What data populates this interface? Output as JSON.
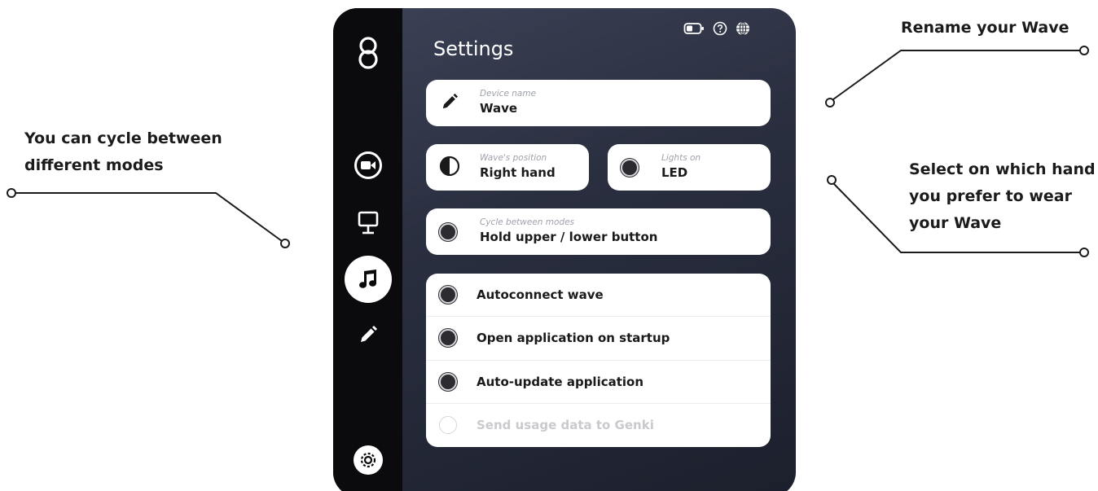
{
  "annotations": {
    "cycle_modes": "You can cycle between different modes",
    "rename": "Rename your Wave",
    "hand": "Select on which hand you prefer to wear your Wave"
  },
  "sidebar": {
    "items": [
      {
        "icon": "logo-icon"
      },
      {
        "icon": "camera-icon"
      },
      {
        "icon": "desktop-icon"
      },
      {
        "icon": "music-icon",
        "active": true
      },
      {
        "icon": "edit-icon"
      },
      {
        "icon": "settings-icon"
      }
    ]
  },
  "header": {
    "title": "Settings",
    "icons": [
      "battery-icon",
      "help-icon",
      "globe-icon"
    ]
  },
  "device_name": {
    "label": "Device name",
    "value": "Wave",
    "icon": "pencil-icon"
  },
  "position": {
    "label": "Wave's position",
    "value": "Right hand",
    "icon": "half-circle-icon"
  },
  "lights": {
    "label": "Lights on",
    "value": "LED"
  },
  "cycle": {
    "label": "Cycle between modes",
    "value": "Hold upper / lower button"
  },
  "toggles": [
    {
      "label": "Autoconnect wave",
      "on": true
    },
    {
      "label": "Open application on startup",
      "on": true
    },
    {
      "label": "Auto-update application",
      "on": true
    },
    {
      "label": "Send usage data to Genki",
      "on": false
    }
  ],
  "colors": {
    "window_bg": "#2a2f40",
    "sidebar_bg": "#0b0b0d",
    "card_bg": "#ffffff",
    "toggle_on": "#2b2b30"
  }
}
